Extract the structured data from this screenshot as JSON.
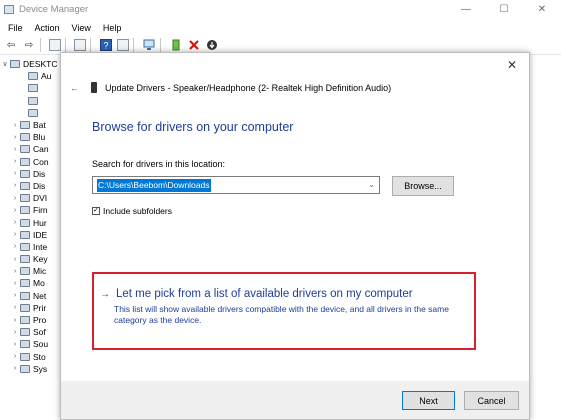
{
  "window": {
    "title": "Device Manager",
    "controls": {
      "minimize": "—",
      "maximize": "☐",
      "close": "✕"
    }
  },
  "menubar": [
    "File",
    "Action",
    "View",
    "Help"
  ],
  "toolbar": {
    "back": "⇦",
    "forward": "⇨"
  },
  "tree": {
    "root": "DESKTC",
    "items": [
      {
        "arrow": "",
        "label": "Au"
      },
      {
        "arrow": "",
        "label": ""
      },
      {
        "arrow": "",
        "label": ""
      },
      {
        "arrow": "",
        "label": ""
      },
      {
        "arrow": "›",
        "label": "Bat"
      },
      {
        "arrow": "›",
        "label": "Blu"
      },
      {
        "arrow": "›",
        "label": "Can"
      },
      {
        "arrow": "›",
        "label": "Con"
      },
      {
        "arrow": "›",
        "label": "Dis"
      },
      {
        "arrow": "›",
        "label": "Dis"
      },
      {
        "arrow": "›",
        "label": "DVI"
      },
      {
        "arrow": "›",
        "label": "Firn"
      },
      {
        "arrow": "›",
        "label": "Hur"
      },
      {
        "arrow": "›",
        "label": "IDE"
      },
      {
        "arrow": "›",
        "label": "Inte"
      },
      {
        "arrow": "›",
        "label": "Key"
      },
      {
        "arrow": "›",
        "label": "Mic"
      },
      {
        "arrow": "›",
        "label": "Mo"
      },
      {
        "arrow": "›",
        "label": "Net"
      },
      {
        "arrow": "›",
        "label": "Prir"
      },
      {
        "arrow": "›",
        "label": "Pro"
      },
      {
        "arrow": "›",
        "label": "Sof"
      },
      {
        "arrow": "›",
        "label": "Sou"
      },
      {
        "arrow": "›",
        "label": "Sto"
      },
      {
        "arrow": "›",
        "label": "Sys"
      }
    ]
  },
  "dialog": {
    "close": "✕",
    "back": "←",
    "header": "Update Drivers - Speaker/Headphone (2- Realtek High Definition Audio)",
    "heading": "Browse for drivers on your computer",
    "search_label": "Search for drivers in this location:",
    "path_value": "C:\\Users\\Beebom\\Downloads",
    "browse_label": "Browse...",
    "include_subfolders": "Include subfolders",
    "include_subfolders_checked": true,
    "pick_arrow": "→",
    "pick_link": "Let me pick from a list of available drivers on my computer",
    "pick_desc": "This list will show available drivers compatible with the device, and all drivers in the same category as the device.",
    "next_label": "Next",
    "cancel_label": "Cancel"
  }
}
